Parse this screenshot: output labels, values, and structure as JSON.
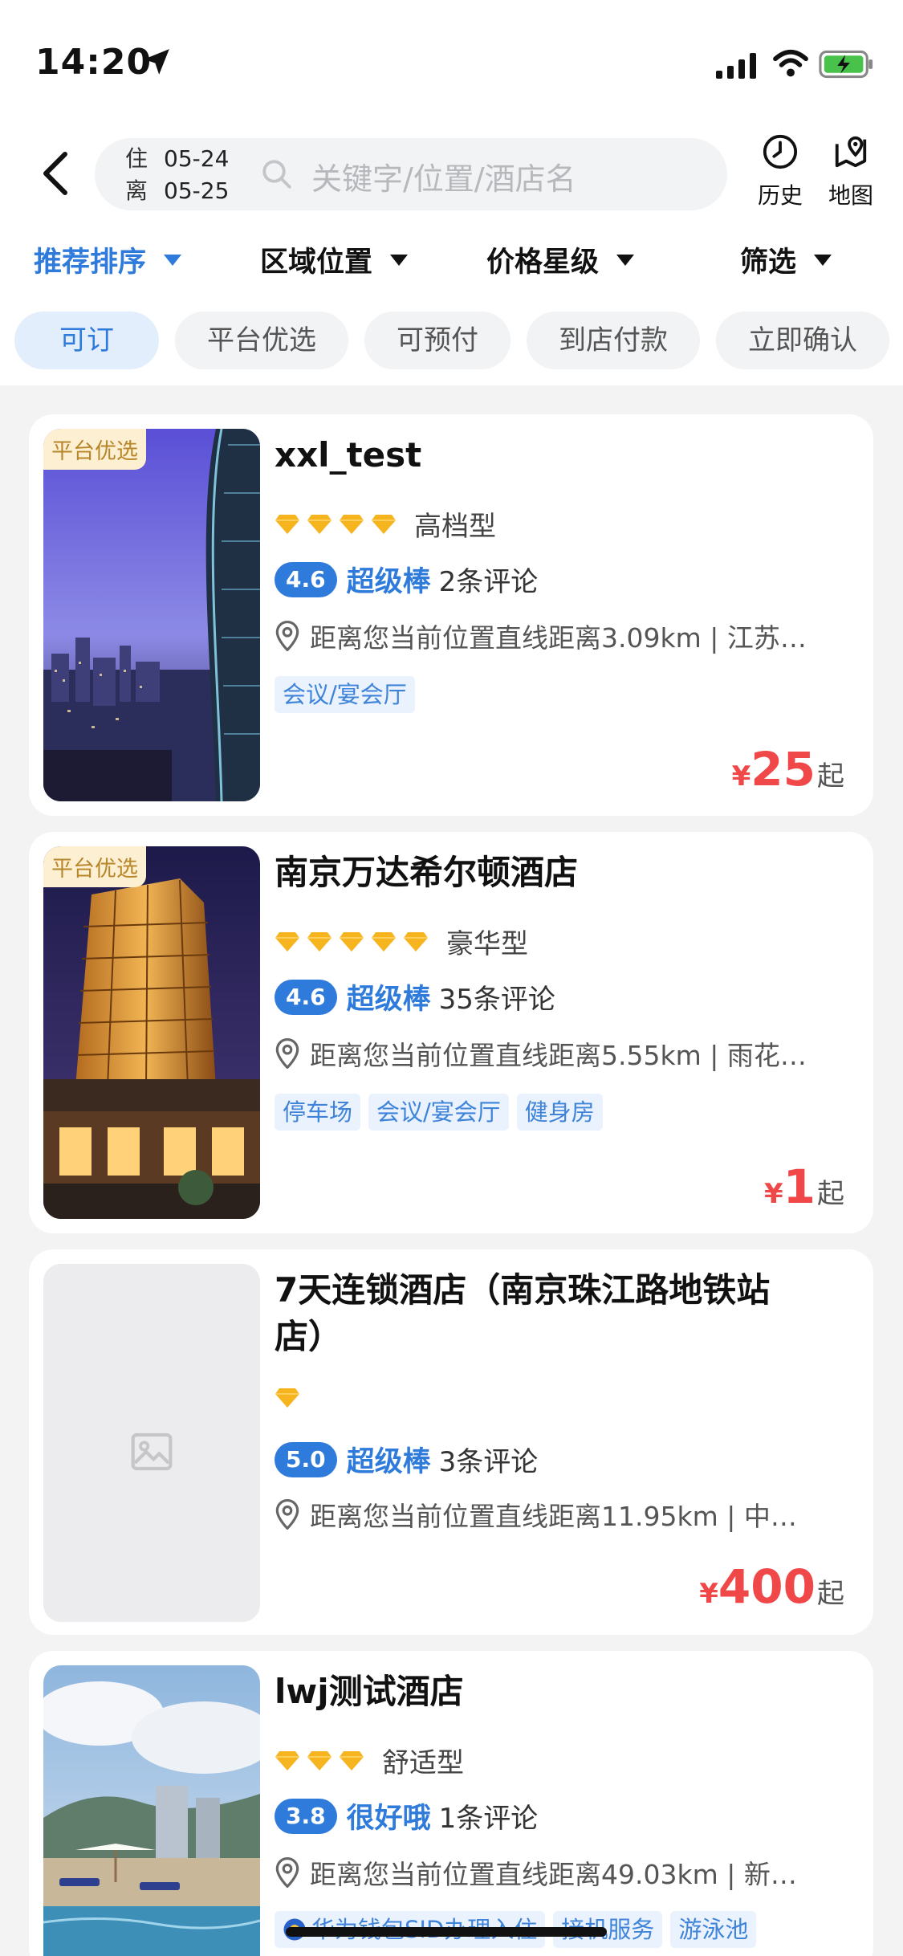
{
  "status_bar": {
    "time": "14:20"
  },
  "search": {
    "checkin_label": "住",
    "checkin_date": "05-24",
    "checkout_label": "离",
    "checkout_date": "05-25",
    "placeholder": "关键字/位置/酒店名"
  },
  "actions": {
    "history": "历史",
    "map": "地图"
  },
  "sort": [
    {
      "label": "推荐排序",
      "active": true
    },
    {
      "label": "区域位置",
      "active": false
    },
    {
      "label": "价格星级",
      "active": false
    },
    {
      "label": "筛选",
      "active": false
    }
  ],
  "chips": [
    "可订",
    "平台优选",
    "可预付",
    "到店付款",
    "立即确认"
  ],
  "hotels": [
    {
      "ribbon": "平台优选",
      "name": "xxl_test",
      "stars": 4,
      "star_label": "高档型",
      "score": "4.6",
      "rank": "超级棒",
      "reviews": "2条评论",
      "address": "距离您当前位置直线距离3.09km | 江苏…",
      "tags": [
        "会议/宴会厅"
      ],
      "currency": "¥",
      "price": "25",
      "price_suffix": "起",
      "image": "night-city-skyline"
    },
    {
      "ribbon": "平台优选",
      "name": "南京万达希尔顿酒店",
      "stars": 5,
      "star_label": "豪华型",
      "score": "4.6",
      "rank": "超级棒",
      "reviews": "35条评论",
      "address": "距离您当前位置直线距离5.55km | 雨花…",
      "tags": [
        "停车场",
        "会议/宴会厅",
        "健身房"
      ],
      "currency": "¥",
      "price": "1",
      "price_suffix": "起",
      "image": "hotel-tower-night"
    },
    {
      "ribbon": "",
      "name_line1": "7天连锁酒店（南京珠江路地铁站",
      "name_line2": "店）",
      "stars": 1,
      "star_label": "",
      "score": "5.0",
      "rank": "超级棒",
      "reviews": "3条评论",
      "address": "距离您当前位置直线距离11.95km | 中…",
      "tags": [],
      "currency": "¥",
      "price": "400",
      "price_suffix": "起",
      "image": "placeholder-image-icon"
    },
    {
      "ribbon": "",
      "name": "lwj测试酒店",
      "stars": 3,
      "star_label": "舒适型",
      "score": "3.8",
      "rank": "很好哦",
      "reviews": "1条评论",
      "address": "距离您当前位置直线距离49.03km | 新…",
      "tags": [
        "华为钱包SID办理入住",
        "接机服务",
        "游泳池"
      ],
      "image": "pool-resort"
    }
  ],
  "colors": {
    "accent": "#2f7bdc",
    "price": "#f04848",
    "star": "#f6b41f",
    "ribbon_bg": "#fdf0d2"
  }
}
